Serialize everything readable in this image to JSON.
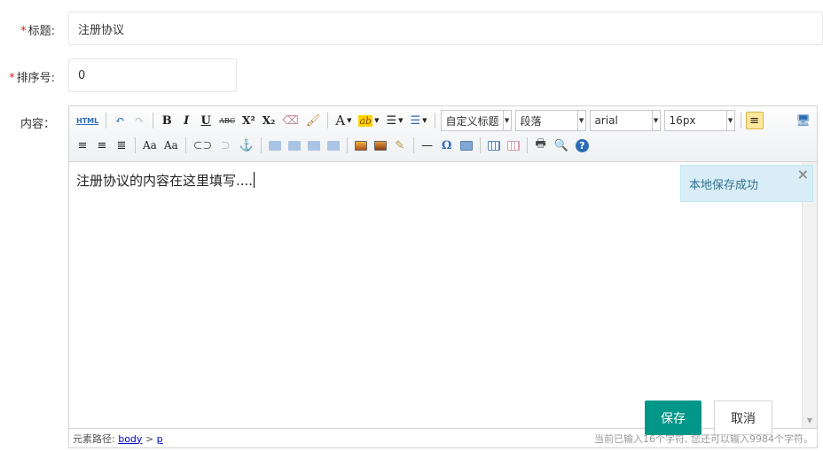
{
  "form": {
    "title_label": "标题:",
    "title_value": "注册协议",
    "sort_label": "排序号:",
    "sort_value": "0",
    "content_label": "内容：",
    "required_mark": "*"
  },
  "toolbar": {
    "html_label": "HTML",
    "bold": "B",
    "italic": "I",
    "underline": "U",
    "strike": "ABC",
    "superscript": "X²",
    "subscript": "X₂",
    "font_color": "A",
    "custom_heading": "自定义标题",
    "paragraph": "段落",
    "font_family": "arial",
    "font_size": "16px",
    "special_char": "Ω"
  },
  "editor": {
    "content_text": "注册协议的内容在这里填写....",
    "path_label": "元素路径:",
    "path_body": "body",
    "path_sep": ">",
    "path_p": "p",
    "char_count": "当前已输入16个字符, 您还可以输入9984个字符。"
  },
  "notice": {
    "text": "本地保存成功",
    "close": "×"
  },
  "buttons": {
    "save": "保存",
    "cancel": "取消"
  },
  "colors": {
    "accent": "#009688",
    "required": "#e2231a",
    "notice_bg": "#d9edf7",
    "notice_text": "#31708f",
    "link": "#0000cc"
  }
}
